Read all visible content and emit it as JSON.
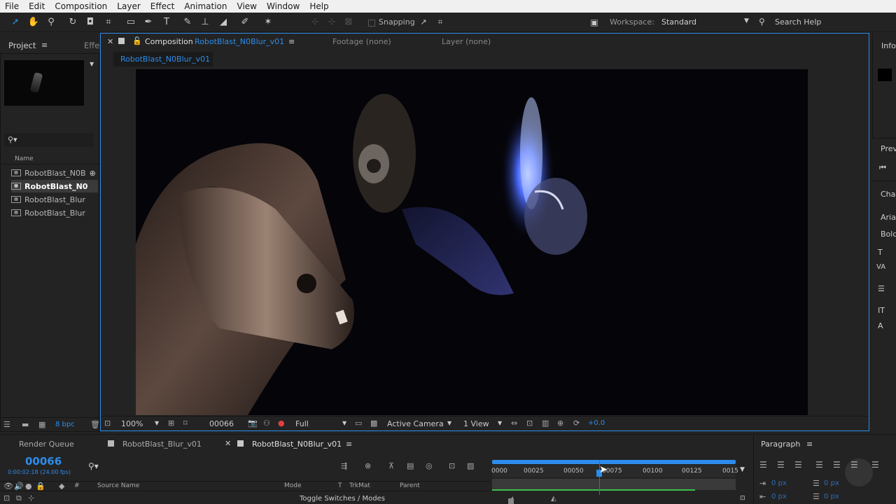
{
  "menu": [
    "File",
    "Edit",
    "Composition",
    "Layer",
    "Effect",
    "Animation",
    "View",
    "Window",
    "Help"
  ],
  "toolbar": {
    "snapping_label": "Snapping",
    "workspace_label": "Workspace:",
    "workspace_value": "Standard",
    "search_help": "Search Help"
  },
  "project_panel": {
    "title": "Project",
    "effects_tab": "Effe",
    "column_name": "Name",
    "items": [
      "RobotBlast_N0B",
      "RobotBlast_N0",
      "RobotBlast_Blur",
      "RobotBlast_Blur"
    ],
    "bpc": "8 bpc"
  },
  "comp_panel": {
    "tab_prefix": "Composition",
    "comp_name": "RobotBlast_N0Blur_v01",
    "footage_tab": "Footage (none)",
    "layer_tab": "Layer (none)",
    "sub_tab": "RobotBlast_N0Blur_v01",
    "zoom": "100%",
    "timecode": "00066",
    "resolution": "Full",
    "camera": "Active Camera",
    "views": "1 View",
    "exposure": "+0.0"
  },
  "right_panels": {
    "info": "Info",
    "preview": "Prev",
    "character": "Char",
    "font": "Arial",
    "style": "Bold"
  },
  "timeline": {
    "render_queue": "Render Queue",
    "tab1": "RobotBlast_Blur_v01",
    "tab2": "RobotBlast_N0Blur_v01",
    "current_frame": "00066",
    "timecode_detail": "0:00:02:18 (24.00 fps)",
    "ticks": [
      "0000",
      "00025",
      "00050",
      "00075",
      "00100",
      "00125",
      "0015"
    ],
    "col_source": "Source Name",
    "col_mode": "Mode",
    "col_t": "T",
    "col_trkmat": "TrkMat",
    "col_parent": "Parent",
    "toggle_label": "Toggle Switches / Modes",
    "playhead_frame": 66
  },
  "paragraph": {
    "title": "Paragraph",
    "indent1": "0 px",
    "indent2": "0 px",
    "indent3": "0 px",
    "indent4": "0 px"
  },
  "colors": {
    "accent": "#2d8ceb",
    "playhead": "#d8343c",
    "work_area": "#3bbf4a"
  }
}
